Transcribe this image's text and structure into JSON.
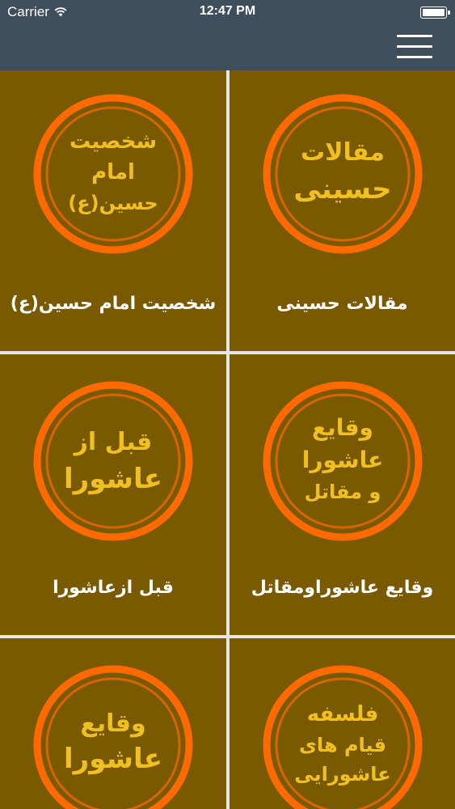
{
  "status_bar": {
    "carrier": "Carrier",
    "time": "12:47 PM"
  },
  "nav": {
    "menu_icon": "hamburger-menu-icon"
  },
  "tiles": [
    {
      "label": "مقالات حسینی",
      "emblem_lines": [
        "مقالات",
        "حسینی"
      ]
    },
    {
      "label": "شخصیت امام حسین(ع)",
      "emblem_lines": [
        "شخصیت",
        "امام",
        "حسین(ع)"
      ]
    },
    {
      "label": "وقایع عاشوراومقاتل",
      "emblem_lines": [
        "وقایع",
        "عاشورا",
        "و مقاتل"
      ]
    },
    {
      "label": "قبل ازعاشورا",
      "emblem_lines": [
        "قبل از",
        "عاشورا"
      ]
    },
    {
      "label": "",
      "emblem_lines": [
        "فلسفه",
        "قیام های",
        "عاشورایی"
      ]
    },
    {
      "label": "",
      "emblem_lines": [
        "وقایع",
        "عاشورا"
      ]
    }
  ],
  "colors": {
    "header_bg": "#3f4e5c",
    "tile_bg": "#7a5a00",
    "ring": "#ff6a00",
    "emblem_text": "#f0c020",
    "label_text": "#ffffff",
    "divider": "#e6e6e6"
  }
}
